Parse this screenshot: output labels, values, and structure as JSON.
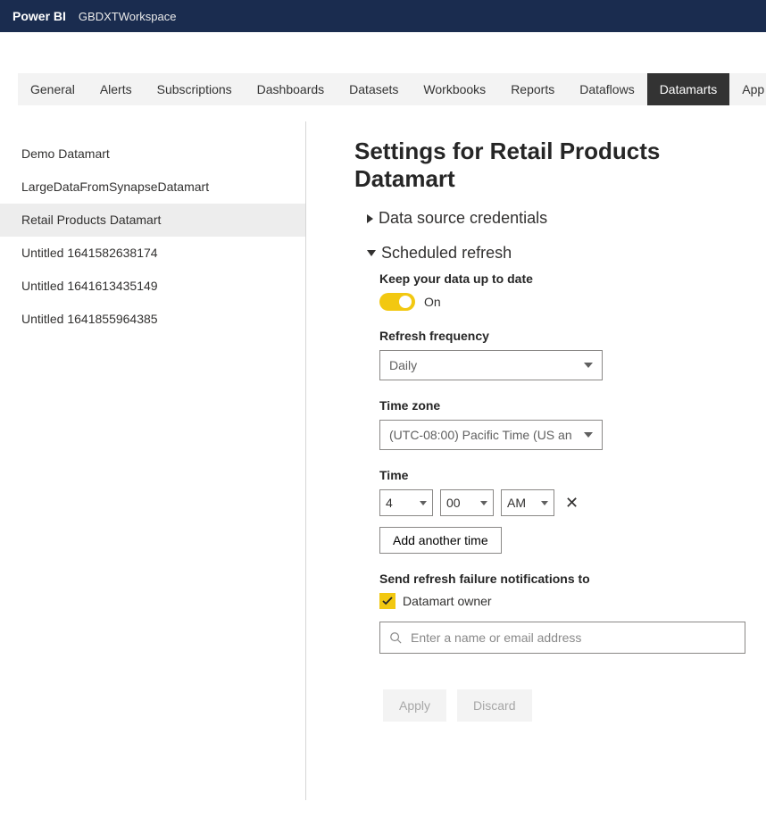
{
  "header": {
    "brand": "Power BI",
    "workspace": "GBDXTWorkspace"
  },
  "tabs": [
    {
      "label": "General",
      "active": false
    },
    {
      "label": "Alerts",
      "active": false
    },
    {
      "label": "Subscriptions",
      "active": false
    },
    {
      "label": "Dashboards",
      "active": false
    },
    {
      "label": "Datasets",
      "active": false
    },
    {
      "label": "Workbooks",
      "active": false
    },
    {
      "label": "Reports",
      "active": false
    },
    {
      "label": "Dataflows",
      "active": false
    },
    {
      "label": "Datamarts",
      "active": true
    },
    {
      "label": "App",
      "active": false
    }
  ],
  "sidebar": {
    "items": [
      {
        "label": "Demo Datamart",
        "selected": false
      },
      {
        "label": "LargeDataFromSynapseDatamart",
        "selected": false
      },
      {
        "label": "Retail Products Datamart",
        "selected": true
      },
      {
        "label": "Untitled 1641582638174",
        "selected": false
      },
      {
        "label": "Untitled 1641613435149",
        "selected": false
      },
      {
        "label": "Untitled 1641855964385",
        "selected": false
      }
    ]
  },
  "main": {
    "title": "Settings for Retail Products Datamart",
    "sections": {
      "credentials": {
        "label": "Data source credentials",
        "expanded": false
      },
      "refresh": {
        "label": "Scheduled refresh",
        "expanded": true,
        "keep_label": "Keep your data up to date",
        "toggle_on_label": "On",
        "freq_label": "Refresh frequency",
        "freq_value": "Daily",
        "tz_label": "Time zone",
        "tz_value": "(UTC-08:00) Pacific Time (US an",
        "time_label": "Time",
        "time_hour": "4",
        "time_min": "00",
        "time_ampm": "AM",
        "add_time_label": "Add another time",
        "notify_label": "Send refresh failure notifications to",
        "owner_chk_label": "Datamart owner",
        "search_placeholder": "Enter a name or email address",
        "apply_label": "Apply",
        "discard_label": "Discard"
      }
    }
  }
}
